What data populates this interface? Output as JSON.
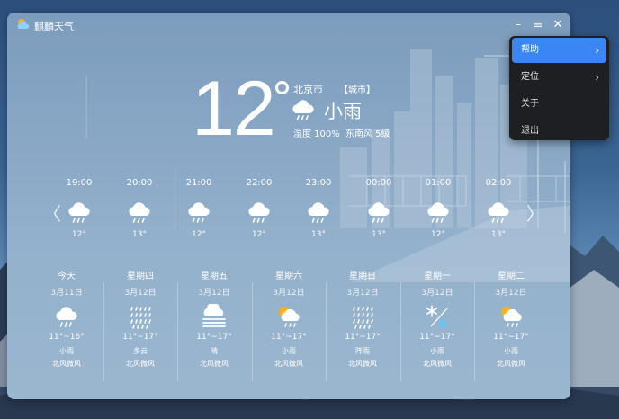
{
  "app": {
    "title": "麒麟天气",
    "minimize_label": "–",
    "menu_label": "≡",
    "close_label": "✕"
  },
  "current": {
    "temperature": "12",
    "city": "北京市",
    "city_tag": "【城市】",
    "condition": "小雨",
    "humidity": "湿度 100%",
    "wind": "东南风 5级",
    "icon": "cloud-rain-icon"
  },
  "hourly_nav": {
    "prev": "〈",
    "next": "〉"
  },
  "hourly": [
    {
      "time": "19:00",
      "temp": "12°",
      "icon": "cloud-rain-icon"
    },
    {
      "time": "20:00",
      "temp": "13°",
      "icon": "cloud-rain-icon"
    },
    {
      "time": "21:00",
      "temp": "12°",
      "icon": "cloud-rain-icon"
    },
    {
      "time": "22:00",
      "temp": "12°",
      "icon": "cloud-rain-icon"
    },
    {
      "time": "23:00",
      "temp": "13°",
      "icon": "cloud-rain-icon"
    },
    {
      "time": "00:00",
      "temp": "13°",
      "icon": "cloud-rain-icon"
    },
    {
      "time": "01:00",
      "temp": "12°",
      "icon": "cloud-rain-icon"
    },
    {
      "time": "02:00",
      "temp": "13°",
      "icon": "cloud-rain-icon"
    }
  ],
  "daily": [
    {
      "name": "今天",
      "date": "3月11日",
      "range": "11°~16°",
      "cond": "小雨",
      "wind": "北风微风",
      "icon": "cloud-rain-icon"
    },
    {
      "name": "星期四",
      "date": "3月12日",
      "range": "11°~17°",
      "cond": "多云",
      "wind": "北风微风",
      "icon": "heavy-rain-icon"
    },
    {
      "name": "星期五",
      "date": "3月12日",
      "range": "11°~17°",
      "cond": "晴",
      "wind": "北风微风",
      "icon": "fog-icon"
    },
    {
      "name": "星期六",
      "date": "3月12日",
      "range": "11°~17°",
      "cond": "小雨",
      "wind": "北风微风",
      "icon": "sun-cloud-rain-icon"
    },
    {
      "name": "星期日",
      "date": "3月12日",
      "range": "11°~17°",
      "cond": "阵雨",
      "wind": "北风微风",
      "icon": "heavy-rain-icon"
    },
    {
      "name": "星期一",
      "date": "3月12日",
      "range": "11°~17°",
      "cond": "小雨",
      "wind": "北风微风",
      "icon": "snow-rain-icon"
    },
    {
      "name": "星期二",
      "date": "3月12日",
      "range": "11°~17°",
      "cond": "小雨",
      "wind": "北风微风",
      "icon": "sun-cloud-rain-icon"
    }
  ],
  "menu": {
    "items": [
      {
        "label": "帮助",
        "chevron": "›",
        "active": true
      },
      {
        "label": "定位",
        "chevron": "›",
        "active": false
      },
      {
        "label": "关于",
        "chevron": "",
        "active": false
      },
      {
        "label": "退出",
        "chevron": "",
        "active": false
      }
    ]
  },
  "colors": {
    "menu_highlight": "#3a86f5",
    "menu_bg": "#1e1f22",
    "sun": "#f5b21c"
  }
}
